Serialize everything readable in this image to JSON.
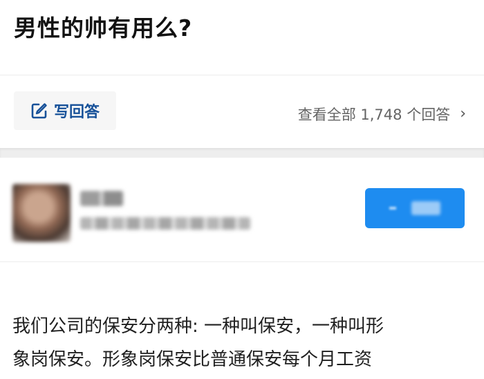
{
  "question": {
    "title": "男性的帅有用么?"
  },
  "actions": {
    "write_answer_label": "写回答",
    "write_answer_icon": "edit-icon",
    "view_all_label": "查看全部 1,748 个回答",
    "view_all_icon": "chevron-right-icon"
  },
  "author": {
    "avatar": "blurred",
    "follow_button_color": "#1e8cf0"
  },
  "answer": {
    "lines": [
      "我们公司的保安分两种: 一种叫保安，一种叫形",
      "象岗保安。形象岗保安比普通保安每个月工资"
    ]
  }
}
